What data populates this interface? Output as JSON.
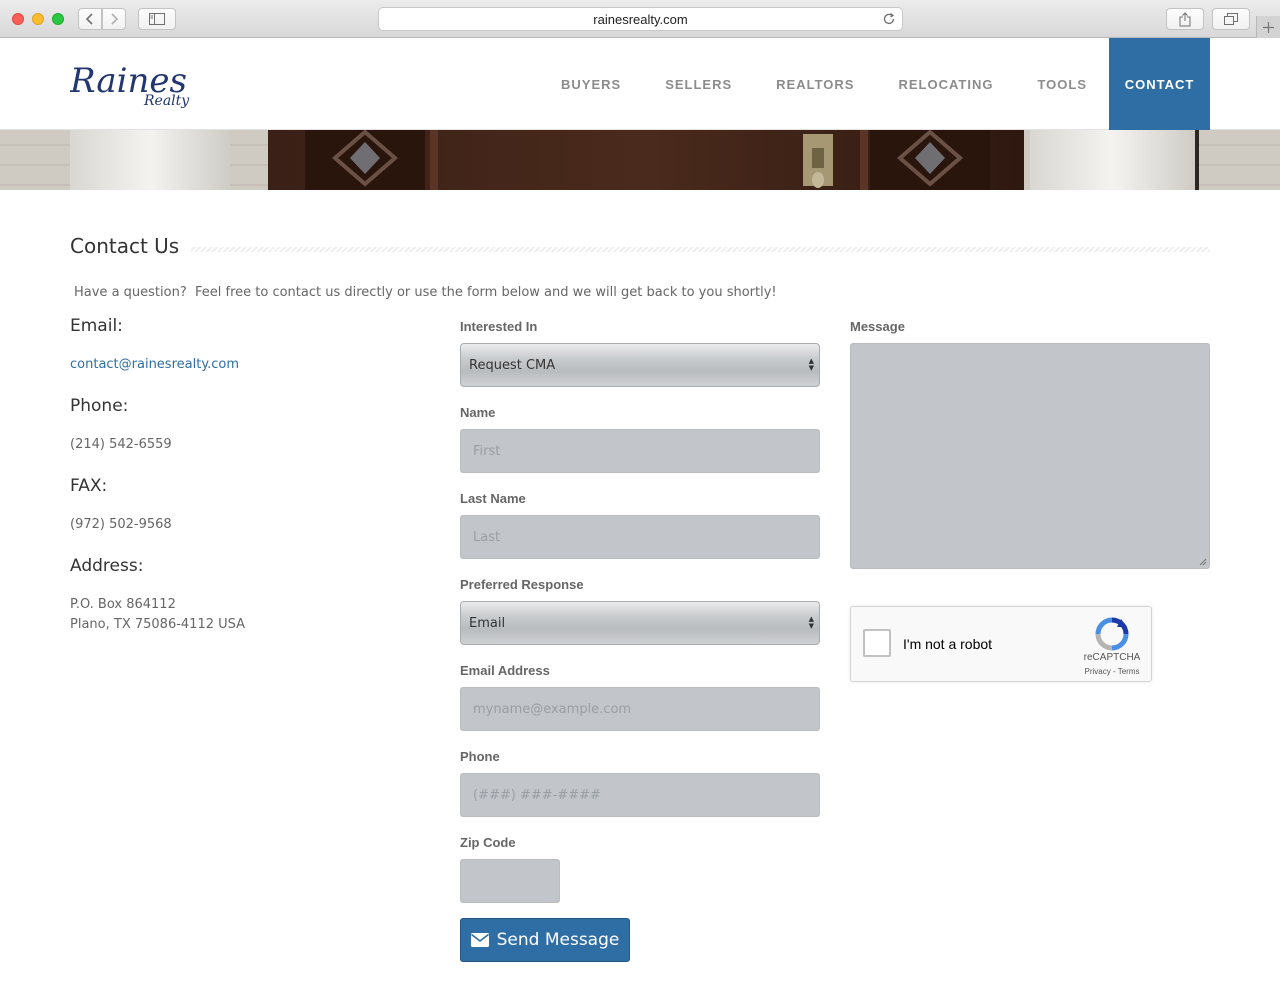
{
  "browser": {
    "url": "rainesrealty.com"
  },
  "header": {
    "logo_main": "Raines",
    "logo_sub": "Realty",
    "nav": [
      {
        "label": "BUYERS",
        "active": false
      },
      {
        "label": "SELLERS",
        "active": false
      },
      {
        "label": "REALTORS",
        "active": false
      },
      {
        "label": "RELOCATING",
        "active": false
      },
      {
        "label": "TOOLS",
        "active": false
      },
      {
        "label": "CONTACT",
        "active": true
      }
    ]
  },
  "page": {
    "title": "Contact Us",
    "intro": "Have a question?  Feel free to contact us directly or use the form below and we will get back to you shortly!"
  },
  "contact_info": {
    "email_heading": "Email:",
    "email": "contact@rainesrealty.com",
    "phone_heading": "Phone:",
    "phone": "(214) 542-6559",
    "fax_heading": "FAX:",
    "fax": "(972) 502-9568",
    "address_heading": "Address:",
    "address_line1": "P.O. Box 864112",
    "address_line2": "Plano, TX 75086-4112 USA"
  },
  "form": {
    "interested_label": "Interested In",
    "interested_value": "Request CMA",
    "name_label": "Name",
    "name_placeholder": "First",
    "lastname_label": "Last Name",
    "lastname_placeholder": "Last",
    "response_label": "Preferred Response",
    "response_value": "Email",
    "email_label": "Email Address",
    "email_placeholder": "myname@example.com",
    "phone_label": "Phone",
    "phone_placeholder": "(###) ###-####",
    "zip_label": "Zip Code",
    "message_label": "Message",
    "send_label": "Send Message"
  },
  "recaptcha": {
    "label": "I'm not a robot",
    "brand": "reCAPTCHA",
    "terms": "Privacy - Terms"
  },
  "colors": {
    "accent": "#2f6ea5",
    "input_bg": "#c2c5c9"
  }
}
